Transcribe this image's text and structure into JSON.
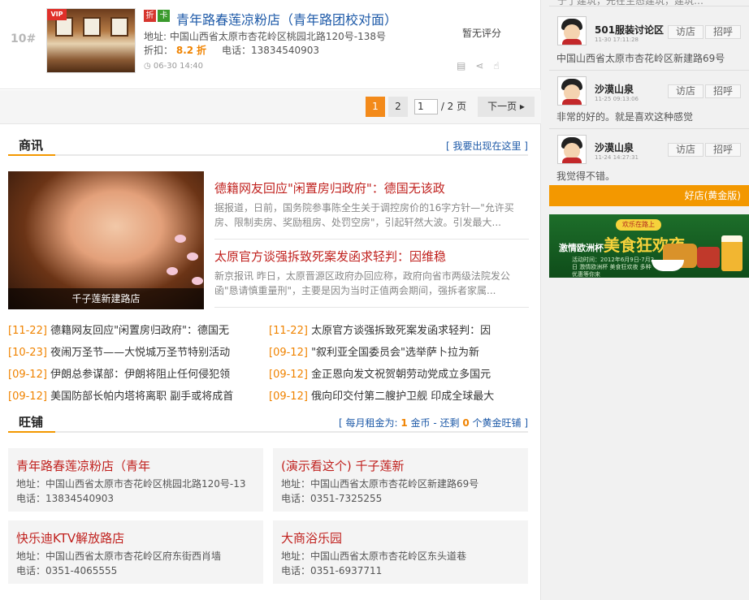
{
  "listing": {
    "rank": "10#",
    "vip": "VIP",
    "badge_zhe": "折",
    "badge_ka": "卡",
    "title": "青年路春莲凉粉店（青年路团校对面）",
    "address": "地址: 中国山西省太原市杏花岭区桃园北路120号-138号",
    "discount_label": "折扣：",
    "discount_value": "8.2",
    "discount_unit": "折",
    "phone": "电话：13834540903",
    "time": "06-30 14:40",
    "rating": "暂无评分"
  },
  "pager": {
    "current": "1",
    "page2": "2",
    "input_value": "1",
    "total": "/ 2 页",
    "next": "下一页"
  },
  "news_section": {
    "title": "商讯",
    "link": "[ 我要出现在这里 ]",
    "image_caption": "千子莲新建路店",
    "headline1": "德籍网友回应\"闲置房归政府\"：德国无该政",
    "summary1": "据报道，日前，国务院参事陈全生关于调控房价的16字方针—\"允许买房、限制卖房、奖励租房、处罚空房\"，引起轩然大波。引发最大...",
    "headline2": "太原官方谈强拆致死案发函求轻判：因维稳",
    "summary2": "新京报讯 昨日，太原晋源区政府办回应称，政府向省市两级法院发公函\"恳请慎重量刑\"，主要是因为当时正值两会期间，强拆者家属...",
    "list_left": [
      {
        "date": "[11-22]",
        "text": "德籍网友回应\"闲置房归政府\"：德国无"
      },
      {
        "date": "[10-23]",
        "text": "夜闹万圣节——大悦城万圣节特别活动"
      },
      {
        "date": "[09-12]",
        "text": "伊朗总参谋部：伊朗将阻止任何侵犯领"
      },
      {
        "date": "[09-12]",
        "text": "美国防部长帕内塔将离职 副手或将成首"
      }
    ],
    "list_right": [
      {
        "date": "[11-22]",
        "text": "太原官方谈强拆致死案发函求轻判：因"
      },
      {
        "date": "[09-12]",
        "text": "\"叙利亚全国委员会\"选举萨卜拉为新"
      },
      {
        "date": "[09-12]",
        "text": "金正恩向发文祝贺朝劳动党成立多国元"
      },
      {
        "date": "[09-12]",
        "text": "俄向印交付第二艘护卫舰 印成全球最大"
      }
    ]
  },
  "shops_section": {
    "title": "旺铺",
    "rent_prefix": "[ 每月租金为: ",
    "rent_value": "1",
    "rent_mid": " 金币 - 还剩 ",
    "remain_value": "0",
    "rent_suffix": " 个黄金旺铺 ]",
    "cards": [
      {
        "name": "青年路春莲凉粉店（青年",
        "address": "地址：中国山西省太原市杏花岭区桃园北路120号-13",
        "phone": "电话：13834540903"
      },
      {
        "name": "(演示看这个) 千子莲新",
        "address": "地址：中国山西省太原市杏花岭区新建路69号",
        "phone": "电话：0351-7325255"
      },
      {
        "name": "快乐迪KTV解放路店",
        "address": "地址：中国山西省太原市杏花岭区府东街西肖墙",
        "phone": "电话：0351-4065555"
      },
      {
        "name": "大商浴乐园",
        "address": "地址：中国山西省太原市杏花岭区东头道巷",
        "phone": "电话：0351-6937711"
      }
    ]
  },
  "sidebar": {
    "top_cut": "于了建筑，先在生态建筑，建筑…",
    "comments": [
      {
        "user": "501服装讨论区",
        "time": "11-30 17:11:28",
        "visit": "访店",
        "greet": "招呼",
        "text": "中国山西省太原市杏花岭区新建路69号"
      },
      {
        "user": "沙漠山泉",
        "time": "11-25 09:13:06",
        "visit": "访店",
        "greet": "招呼",
        "text": "非常的好的。就是喜欢这种感觉"
      },
      {
        "user": "沙漠山泉",
        "time": "11-24 14:27:31",
        "visit": "访店",
        "greet": "招呼",
        "text": "我觉得不错。"
      }
    ],
    "orange_bar": "好店(黄金版)",
    "banner": {
      "tag": "欢乐在路上",
      "line1": "激情欧洲杯",
      "line2": "美食狂欢夜",
      "small": "活动时间：2012年6月9日-7月2日 激情欧洲杯 美食狂欢夜 多种优惠等你来"
    }
  }
}
